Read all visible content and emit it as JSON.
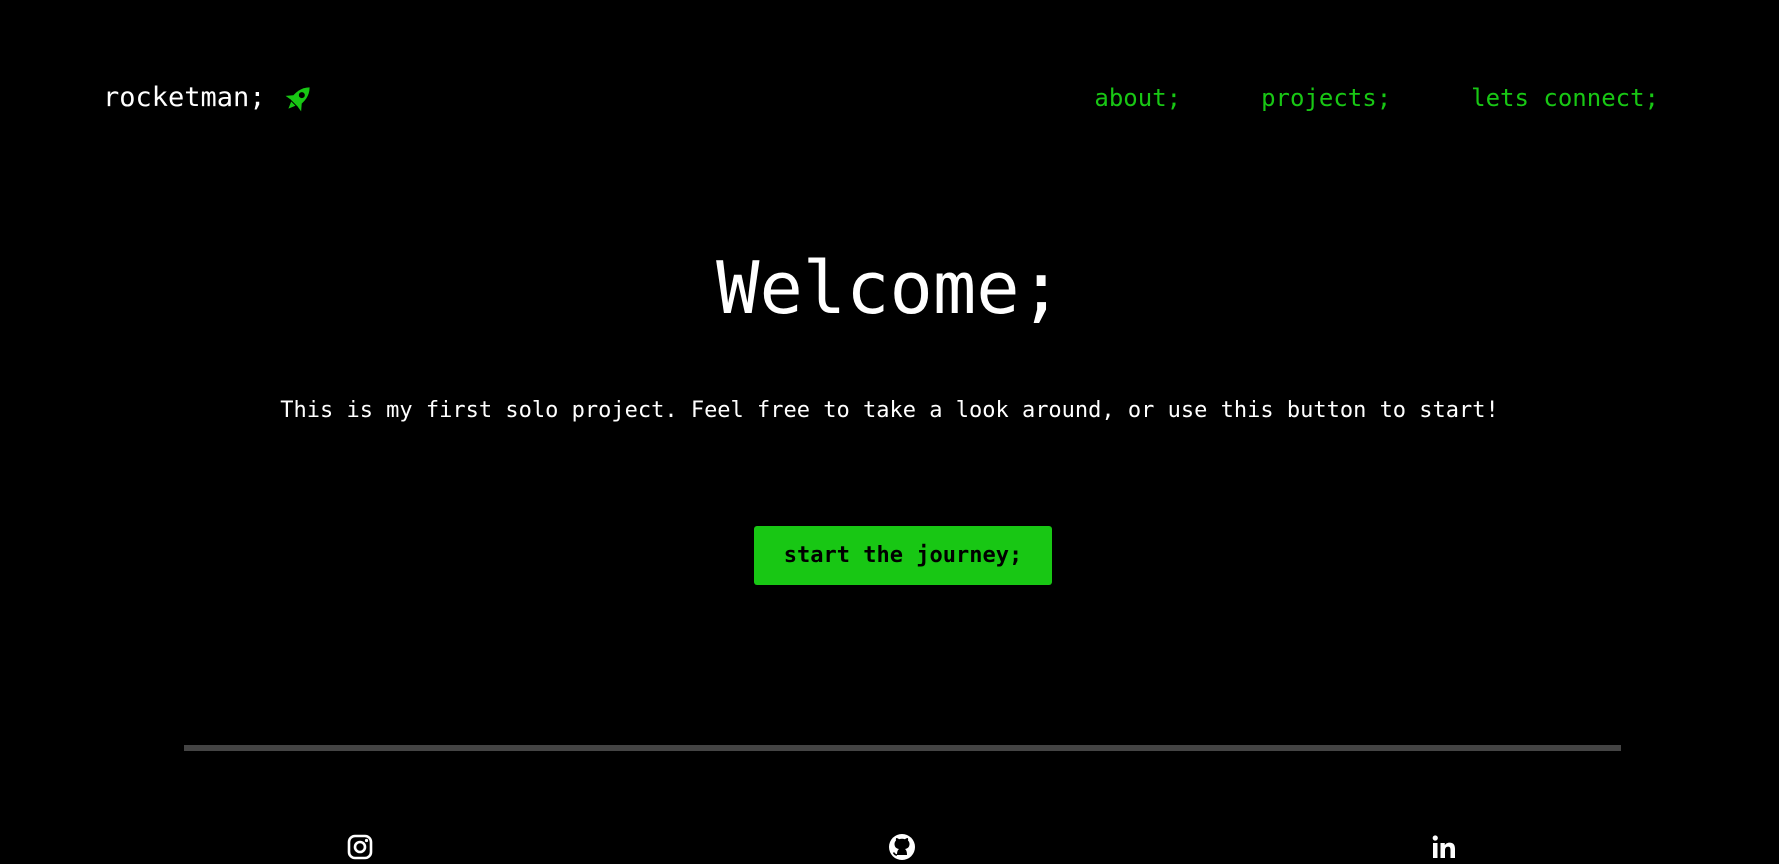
{
  "brand": {
    "name": "rocketman;",
    "icon": "rocket-icon",
    "icon_color": "#18c714"
  },
  "nav": {
    "items": [
      {
        "label": "about;"
      },
      {
        "label": "projects;"
      },
      {
        "label": "lets connect;"
      }
    ]
  },
  "hero": {
    "title": "Welcome;",
    "text": "This is my first solo project. Feel free to take a look around, or use this button to start!",
    "cta_label": "start the journey;"
  },
  "footer": {
    "social": [
      {
        "icon": "instagram-icon"
      },
      {
        "icon": "github-icon"
      },
      {
        "icon": "linkedin-icon"
      }
    ]
  },
  "colors": {
    "background": "#000000",
    "accent": "#18c714",
    "text": "#ffffff",
    "divider": "#444444"
  }
}
